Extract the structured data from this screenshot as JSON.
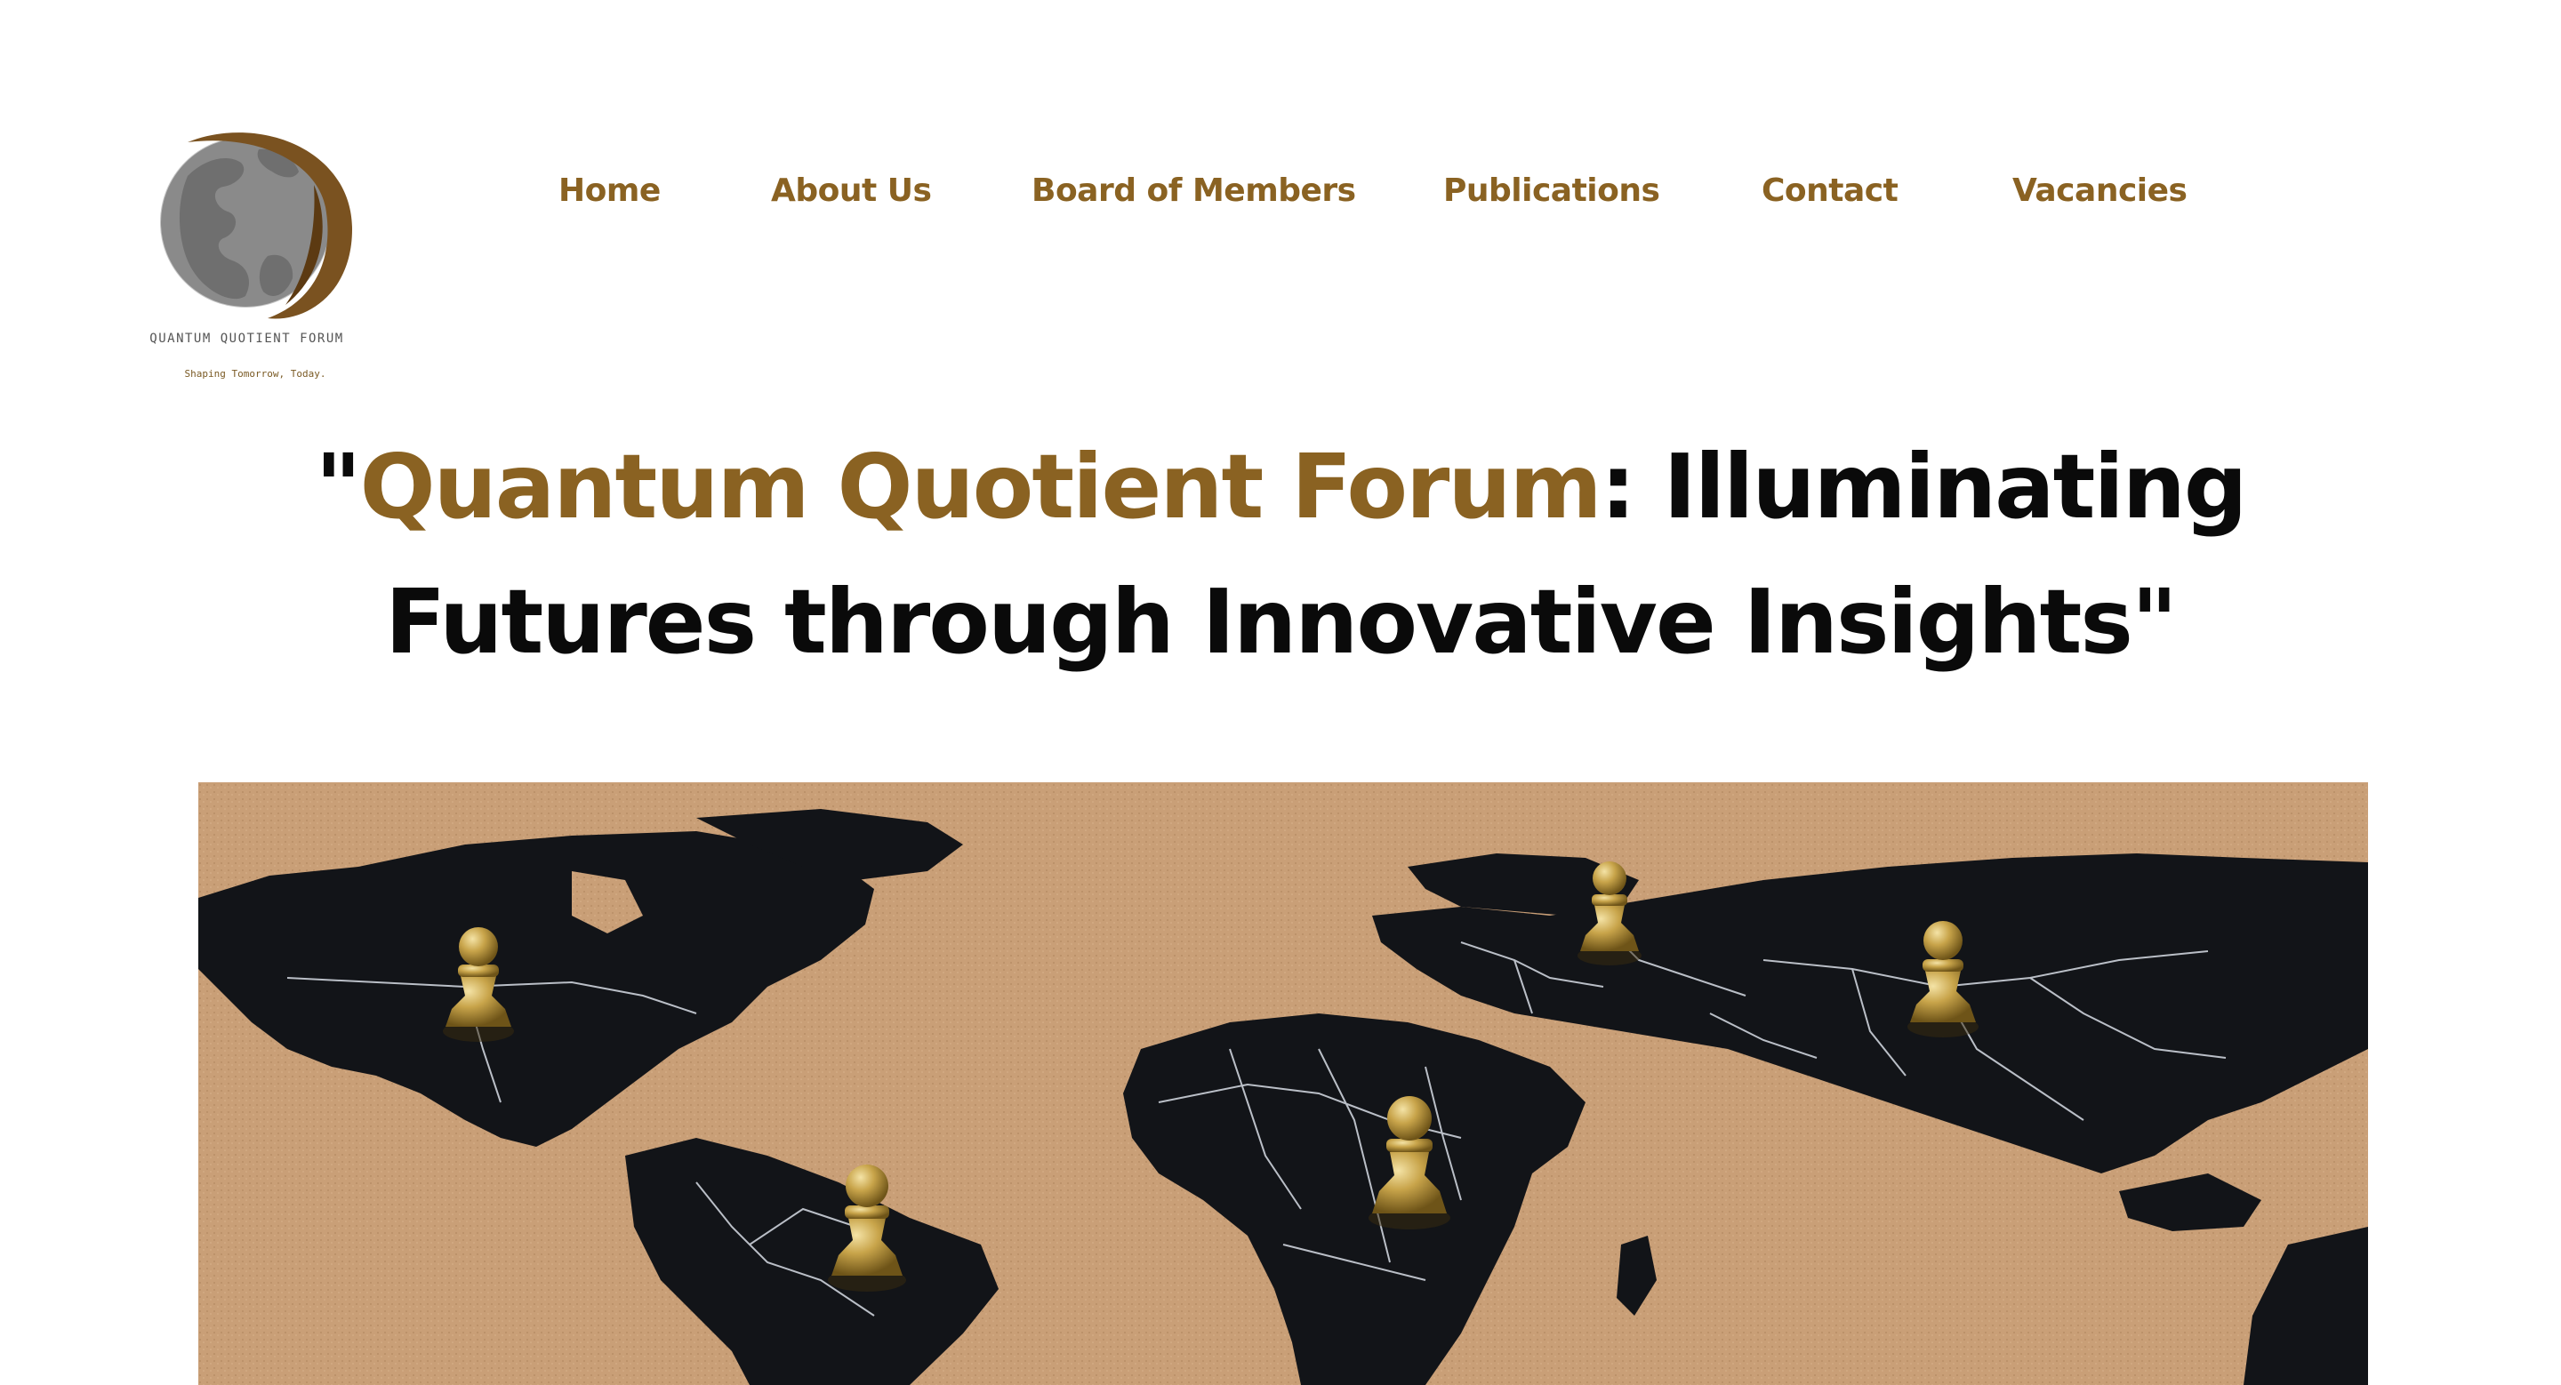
{
  "brand": {
    "name": "QUANTUM QUOTIENT FORUM",
    "tagline": "Shaping Tomorrow, Today.",
    "logo_icon": "globe-leaf-icon"
  },
  "nav": {
    "items": [
      {
        "label": "Home"
      },
      {
        "label": "About Us"
      },
      {
        "label": "Board of Members"
      },
      {
        "label": "Publications"
      },
      {
        "label": "Contact"
      },
      {
        "label": "Vacancies"
      }
    ]
  },
  "hero": {
    "title_open_quote": "\"",
    "title_accent": "Quantum Quotient Forum",
    "title_rest": ": Illuminating Futures through Innovative Insights\"",
    "image": "world-map-with-gold-chess-pawns"
  },
  "colors": {
    "brand_gold": "#8a6222",
    "text_dark": "#0a0a0a",
    "cork": "#c99f77",
    "map_land": "#121418",
    "pawn_gold": "#c8a44a"
  }
}
